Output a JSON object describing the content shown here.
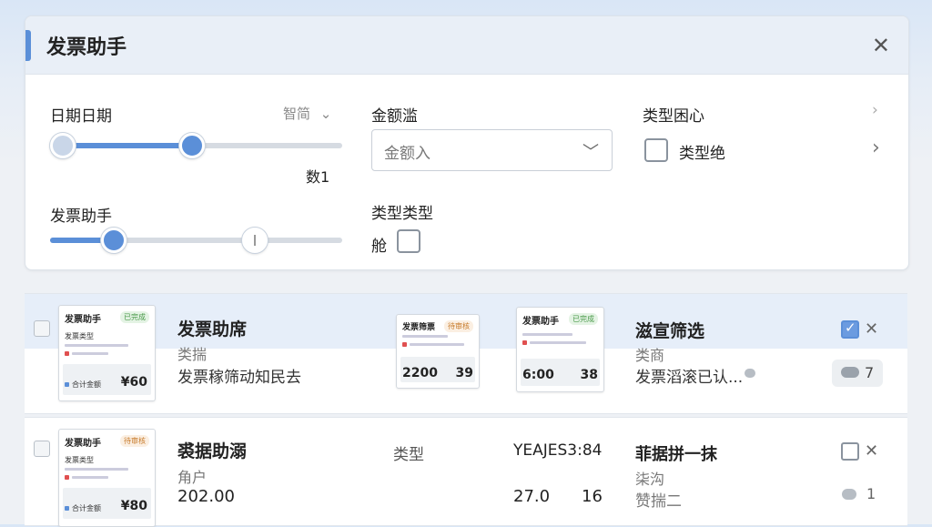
{
  "window": {
    "title": "发票助手",
    "close_icon": "close-icon"
  },
  "filters": {
    "date": {
      "label": "日期日期",
      "dropdown_label": "智简",
      "value_label": "数1",
      "range_start": 0.1,
      "range_end": 0.49
    },
    "amount": {
      "label": "金额滥",
      "placeholder": "金额入"
    },
    "type_center": {
      "label": "类型困心",
      "checkbox_label": "类型绝"
    },
    "assistant": {
      "label": "发票助手",
      "value": 0.22,
      "marker": 0.7
    },
    "type_type": {
      "label": "类型类型",
      "checkbox_label": "舱"
    }
  },
  "rows": [
    {
      "thumb1": {
        "title": "发票助手",
        "tag": "已完成",
        "sub1": "发票类型",
        "sub2": "合计金额",
        "amount": "¥60"
      },
      "title": "发票助席",
      "subtitle": "类揣",
      "desc": "发票稼筛动知民去",
      "thumb2": {
        "title": "发票筛票",
        "tag": "待审核",
        "amount_left": "2200",
        "amount_right": "39"
      },
      "thumb3": {
        "title": "发票助手",
        "tag": "已完成",
        "amount_left": "6:00",
        "amount_right": "38"
      },
      "right_title": "滋宣筛选",
      "right_sub": "类商",
      "right_desc": "发票滔滚已认...",
      "checked": true,
      "comment_count": "7"
    },
    {
      "thumb1": {
        "title": "发票助手",
        "tag": "待审核",
        "sub1": "发票类型",
        "sub2": "合计金额",
        "amount": "¥80"
      },
      "title": "裘据助溺",
      "subtitle": "角户",
      "amount": "202.00",
      "mid_label": "类型",
      "code": "YEAJES3:84",
      "num_left": "27.0",
      "num_right": "16",
      "right_title": "菲据拼一抹",
      "right_sub": "柒沟",
      "right_desc": "赞揣二",
      "checked": false,
      "comment_count": "1"
    }
  ]
}
